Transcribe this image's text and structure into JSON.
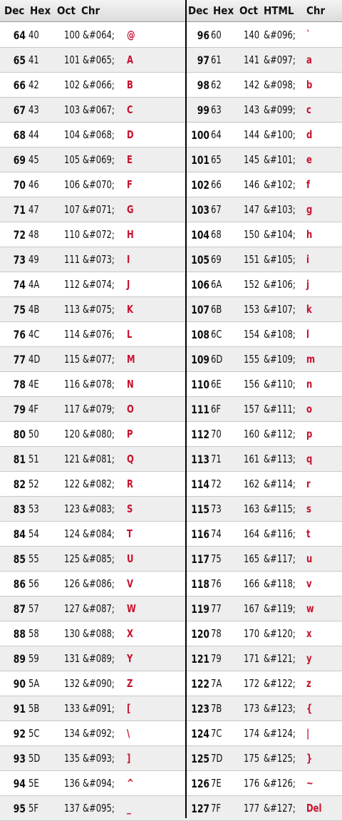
{
  "header": {
    "left": {
      "dec": "Dec",
      "hex": "Hex",
      "oct": "Oct",
      "chr": "Chr"
    },
    "right": {
      "dec": "Dec",
      "hex": "Hex",
      "oct": "Oct",
      "html": "HTML",
      "chr": "Chr"
    }
  },
  "rows": [
    {
      "l": [
        "64",
        "40",
        "100",
        "&#064;",
        "@"
      ],
      "r": [
        "96",
        "60",
        "140",
        "&#096;",
        "`"
      ]
    },
    {
      "l": [
        "65",
        "41",
        "101",
        "&#065;",
        "A"
      ],
      "r": [
        "97",
        "61",
        "141",
        "&#097;",
        "a"
      ]
    },
    {
      "l": [
        "66",
        "42",
        "102",
        "&#066;",
        "B"
      ],
      "r": [
        "98",
        "62",
        "142",
        "&#098;",
        "b"
      ]
    },
    {
      "l": [
        "67",
        "43",
        "103",
        "&#067;",
        "C"
      ],
      "r": [
        "99",
        "63",
        "143",
        "&#099;",
        "c"
      ]
    },
    {
      "l": [
        "68",
        "44",
        "104",
        "&#068;",
        "D"
      ],
      "r": [
        "100",
        "64",
        "144",
        "&#100;",
        "d"
      ]
    },
    {
      "l": [
        "69",
        "45",
        "105",
        "&#069;",
        "E"
      ],
      "r": [
        "101",
        "65",
        "145",
        "&#101;",
        "e"
      ]
    },
    {
      "l": [
        "70",
        "46",
        "106",
        "&#070;",
        "F"
      ],
      "r": [
        "102",
        "66",
        "146",
        "&#102;",
        "f"
      ]
    },
    {
      "l": [
        "71",
        "47",
        "107",
        "&#071;",
        "G"
      ],
      "r": [
        "103",
        "67",
        "147",
        "&#103;",
        "g"
      ]
    },
    {
      "l": [
        "72",
        "48",
        "110",
        "&#072;",
        "H"
      ],
      "r": [
        "104",
        "68",
        "150",
        "&#104;",
        "h"
      ]
    },
    {
      "l": [
        "73",
        "49",
        "111",
        "&#073;",
        "I"
      ],
      "r": [
        "105",
        "69",
        "151",
        "&#105;",
        "i"
      ]
    },
    {
      "l": [
        "74",
        "4A",
        "112",
        "&#074;",
        "J"
      ],
      "r": [
        "106",
        "6A",
        "152",
        "&#106;",
        "j"
      ]
    },
    {
      "l": [
        "75",
        "4B",
        "113",
        "&#075;",
        "K"
      ],
      "r": [
        "107",
        "6B",
        "153",
        "&#107;",
        "k"
      ]
    },
    {
      "l": [
        "76",
        "4C",
        "114",
        "&#076;",
        "L"
      ],
      "r": [
        "108",
        "6C",
        "154",
        "&#108;",
        "l"
      ]
    },
    {
      "l": [
        "77",
        "4D",
        "115",
        "&#077;",
        "M"
      ],
      "r": [
        "109",
        "6D",
        "155",
        "&#109;",
        "m"
      ]
    },
    {
      "l": [
        "78",
        "4E",
        "116",
        "&#078;",
        "N"
      ],
      "r": [
        "110",
        "6E",
        "156",
        "&#110;",
        "n"
      ]
    },
    {
      "l": [
        "79",
        "4F",
        "117",
        "&#079;",
        "O"
      ],
      "r": [
        "111",
        "6F",
        "157",
        "&#111;",
        "o"
      ]
    },
    {
      "l": [
        "80",
        "50",
        "120",
        "&#080;",
        "P"
      ],
      "r": [
        "112",
        "70",
        "160",
        "&#112;",
        "p"
      ]
    },
    {
      "l": [
        "81",
        "51",
        "121",
        "&#081;",
        "Q"
      ],
      "r": [
        "113",
        "71",
        "161",
        "&#113;",
        "q"
      ]
    },
    {
      "l": [
        "82",
        "52",
        "122",
        "&#082;",
        "R"
      ],
      "r": [
        "114",
        "72",
        "162",
        "&#114;",
        "r"
      ]
    },
    {
      "l": [
        "83",
        "53",
        "123",
        "&#083;",
        "S"
      ],
      "r": [
        "115",
        "73",
        "163",
        "&#115;",
        "s"
      ]
    },
    {
      "l": [
        "84",
        "54",
        "124",
        "&#084;",
        "T"
      ],
      "r": [
        "116",
        "74",
        "164",
        "&#116;",
        "t"
      ]
    },
    {
      "l": [
        "85",
        "55",
        "125",
        "&#085;",
        "U"
      ],
      "r": [
        "117",
        "75",
        "165",
        "&#117;",
        "u"
      ]
    },
    {
      "l": [
        "86",
        "56",
        "126",
        "&#086;",
        "V"
      ],
      "r": [
        "118",
        "76",
        "166",
        "&#118;",
        "v"
      ]
    },
    {
      "l": [
        "87",
        "57",
        "127",
        "&#087;",
        "W"
      ],
      "r": [
        "119",
        "77",
        "167",
        "&#119;",
        "w"
      ]
    },
    {
      "l": [
        "88",
        "58",
        "130",
        "&#088;",
        "X"
      ],
      "r": [
        "120",
        "78",
        "170",
        "&#120;",
        "x"
      ]
    },
    {
      "l": [
        "89",
        "59",
        "131",
        "&#089;",
        "Y"
      ],
      "r": [
        "121",
        "79",
        "171",
        "&#121;",
        "y"
      ]
    },
    {
      "l": [
        "90",
        "5A",
        "132",
        "&#090;",
        "Z"
      ],
      "r": [
        "122",
        "7A",
        "172",
        "&#122;",
        "z"
      ]
    },
    {
      "l": [
        "91",
        "5B",
        "133",
        "&#091;",
        "["
      ],
      "r": [
        "123",
        "7B",
        "173",
        "&#123;",
        "{"
      ]
    },
    {
      "l": [
        "92",
        "5C",
        "134",
        "&#092;",
        "\\"
      ],
      "r": [
        "124",
        "7C",
        "174",
        "&#124;",
        "|"
      ]
    },
    {
      "l": [
        "93",
        "5D",
        "135",
        "&#093;",
        "]"
      ],
      "r": [
        "125",
        "7D",
        "175",
        "&#125;",
        "}"
      ]
    },
    {
      "l": [
        "94",
        "5E",
        "136",
        "&#094;",
        "^"
      ],
      "r": [
        "126",
        "7E",
        "176",
        "&#126;",
        "~"
      ]
    },
    {
      "l": [
        "95",
        "5F",
        "137",
        "&#095;",
        "_"
      ],
      "r": [
        "127",
        "7F",
        "177",
        "&#127;",
        "Del"
      ]
    }
  ],
  "colors": {
    "char": "#c8102e",
    "stripe": "#eeeeee",
    "divider": "#000000"
  }
}
